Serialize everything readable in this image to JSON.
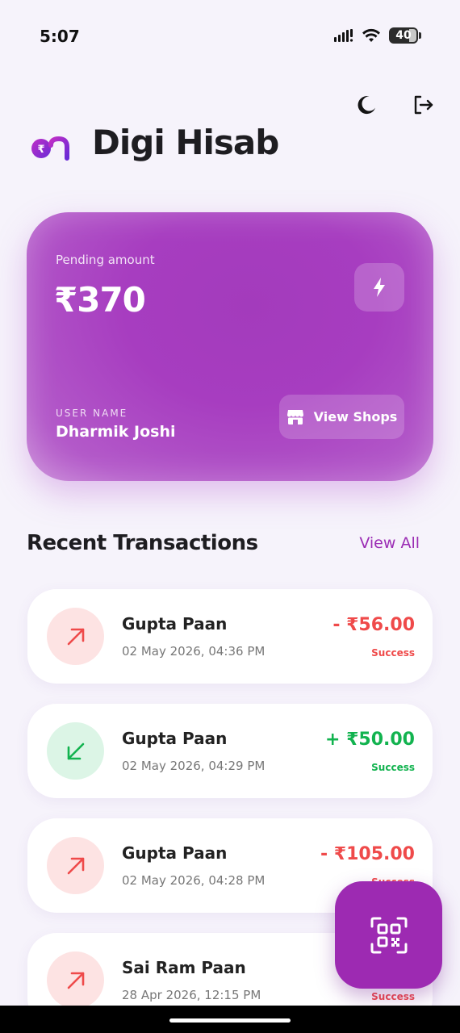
{
  "status_bar": {
    "time": "5:07",
    "battery": "40"
  },
  "header": {
    "app_title": "Digi Hisab",
    "logo_icon": "digi-hisab-logo",
    "theme_toggle_icon": "moon-icon",
    "logout_icon": "logout-icon"
  },
  "balance_card": {
    "pending_label": "Pending amount",
    "pending_amount": "₹370",
    "action_icon": "flash-icon",
    "user_label": "USER NAME",
    "user_name": "Dharmik Joshi",
    "view_shops_label": "View Shops",
    "view_shops_icon": "store-icon"
  },
  "transactions_section": {
    "title": "Recent Transactions",
    "view_all_label": "View All"
  },
  "transactions": [
    {
      "name": "Gupta Paan",
      "date": "02 May 2026, 04:36 PM",
      "amount": "- ₹56.00",
      "status": "Success",
      "type": "debit"
    },
    {
      "name": "Gupta Paan",
      "date": "02 May 2026, 04:29 PM",
      "amount": "+ ₹50.00",
      "status": "Success",
      "type": "credit"
    },
    {
      "name": "Gupta Paan",
      "date": "02 May 2026, 04:28 PM",
      "amount": "- ₹105.00",
      "status": "Success",
      "type": "debit"
    },
    {
      "name": "Sai Ram Paan",
      "date": "28 Apr 2026, 12:15 PM",
      "amount": "",
      "status": "Success",
      "type": "debit"
    }
  ],
  "fab": {
    "icon": "qr-scan-icon"
  },
  "colors": {
    "accent": "#9d2ab2",
    "debit": "#ef4a4a",
    "credit": "#12b34f",
    "background": "#f6f3fb"
  }
}
